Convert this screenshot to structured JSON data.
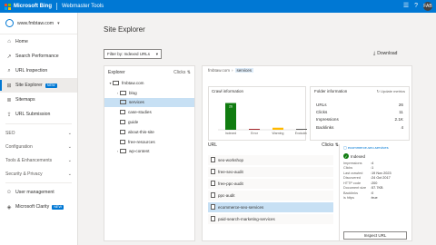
{
  "topbar": {
    "brand": "Microsoft Bing",
    "product": "Webmaster Tools",
    "avatar": "FAB",
    "logo_colors": [
      "#f25022",
      "#7fba00",
      "#00a4ef",
      "#ffb900"
    ]
  },
  "sidebar": {
    "site": "www.fmbtaw.com",
    "items": [
      {
        "label": "Home",
        "icon": "home-icon"
      },
      {
        "label": "Search Performance",
        "icon": "chart-icon"
      },
      {
        "label": "URL Inspection",
        "icon": "search-icon"
      },
      {
        "label": "Site Explorer",
        "icon": "sitemap-icon",
        "badge": "NEW",
        "active": true
      },
      {
        "label": "Sitemaps",
        "icon": "sitemap-file-icon"
      },
      {
        "label": "URL Submission",
        "icon": "submit-icon"
      }
    ],
    "sections": [
      {
        "label": "SEO"
      },
      {
        "label": "Configuration"
      },
      {
        "label": "Tools & Enhancements"
      },
      {
        "label": "Security & Privacy"
      }
    ],
    "bottom_items": [
      {
        "label": "User management",
        "icon": "users-icon"
      },
      {
        "label": "Microsoft Clarity",
        "icon": "clarity-icon",
        "badge": "NEW"
      }
    ]
  },
  "main": {
    "title": "Site Explorer",
    "filter": "Filter by: Indexed URLs",
    "download": "Download"
  },
  "explorer": {
    "header": "Explorer",
    "clicks_label": "Clicks",
    "tree": [
      {
        "label": "fmbtaw.com",
        "level": 0,
        "type": "root",
        "chevron": "▾"
      },
      {
        "label": "blog",
        "level": 1,
        "type": "folder",
        "chevron": "›"
      },
      {
        "label": "services",
        "level": 1,
        "type": "folder",
        "chevron": "",
        "selected": true
      },
      {
        "label": "case-studies",
        "level": 1,
        "type": "page",
        "chevron": ""
      },
      {
        "label": "guide",
        "level": 1,
        "type": "page",
        "chevron": ""
      },
      {
        "label": "about-this-site",
        "level": 1,
        "type": "page",
        "chevron": ""
      },
      {
        "label": "free-resources",
        "level": 1,
        "type": "page",
        "chevron": ""
      },
      {
        "label": "wp-content",
        "level": 1,
        "type": "folder",
        "chevron": "›"
      }
    ]
  },
  "breadcrumb": {
    "root": "fmbtaw.com",
    "current": "services"
  },
  "crawl": {
    "title": "Crawl information",
    "chart_data": {
      "type": "bar",
      "categories": [
        "Indexed",
        "Error",
        "Warning",
        "Excluded"
      ],
      "values": [
        26,
        0,
        2,
        0
      ],
      "value_labels": [
        "26",
        "",
        "",
        ""
      ],
      "colors": [
        "#107c10",
        "#a4262c",
        "#ffb900",
        "#605e5c"
      ],
      "ylim": [
        0,
        30
      ]
    }
  },
  "folder_info": {
    "title": "Folder information",
    "link": "Update metrics",
    "rows": [
      {
        "label": "URLs",
        "value": "26"
      },
      {
        "label": "Clicks",
        "value": "11"
      },
      {
        "label": "Impressions",
        "value": "2.1K"
      },
      {
        "label": "Backlinks",
        "value": "4"
      }
    ]
  },
  "urls": {
    "header": "URL",
    "clicks_label": "Clicks",
    "rows": [
      {
        "label": "seo-workshop"
      },
      {
        "label": "free-seo-audit"
      },
      {
        "label": "free-ppc-audit"
      },
      {
        "label": "ppc-audit"
      },
      {
        "label": "ecommerce-seo-services",
        "selected": true
      },
      {
        "label": "paid-search-marketing-services"
      }
    ]
  },
  "detail": {
    "url": "ecommerce-seo-services",
    "status": "Indexed",
    "rows": [
      {
        "k": "Impressions",
        "v": "4"
      },
      {
        "k": "Clicks",
        "v": "1"
      },
      {
        "k": "Last crawled",
        "v": "19 Nov 2023"
      },
      {
        "k": "Discovered",
        "v": "24 Oct 2017"
      },
      {
        "k": "HTTP code",
        "v": "200"
      },
      {
        "k": "Document size",
        "v": "57.7KB"
      },
      {
        "k": "Backlinks",
        "v": "0"
      },
      {
        "k": "is https",
        "v": "true"
      }
    ],
    "inspect": "Inspect URL"
  }
}
